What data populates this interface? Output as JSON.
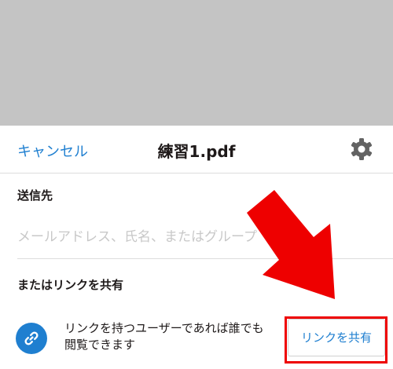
{
  "header": {
    "cancel_label": "キャンセル",
    "title": "練習1.pdf"
  },
  "to_section": {
    "label": "送信先",
    "placeholder": "メールアドレス、氏名、またはグループ"
  },
  "link_section": {
    "label": "またはリンクを共有",
    "description": "リンクを持つユーザーであれば誰でも閲覧できます",
    "share_button_label": "リンクを共有"
  },
  "icons": {
    "settings": "gear-icon",
    "link": "link-icon"
  },
  "colors": {
    "accent": "#1f7fd0",
    "annotation": "#ee0000",
    "backdrop": "#c4c4c4"
  }
}
